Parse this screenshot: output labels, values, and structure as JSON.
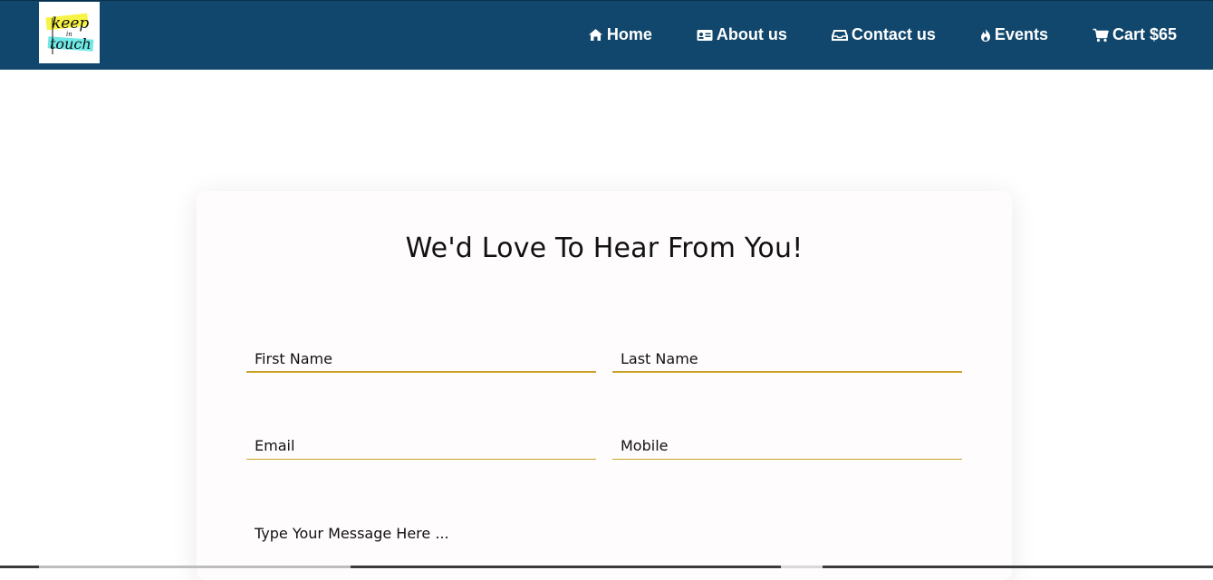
{
  "logo": {
    "line1": "keep",
    "line2": "in",
    "line3": "touch"
  },
  "nav": {
    "items": [
      {
        "label": "Home",
        "icon": "home-icon"
      },
      {
        "label": "About us",
        "icon": "id-card-icon"
      },
      {
        "label": "Contact us",
        "icon": "inbox-icon"
      },
      {
        "label": "Events",
        "icon": "fire-icon"
      },
      {
        "label": "Cart $65",
        "icon": "cart-icon"
      }
    ]
  },
  "form": {
    "title": "We'd Love To Hear From You!",
    "first_name_placeholder": "First Name",
    "last_name_placeholder": "Last Name",
    "email_placeholder": "Email",
    "mobile_placeholder": "Mobile",
    "message_placeholder": "Type Your Message Here ..."
  },
  "colors": {
    "navbar": "#11476c",
    "field_underline": "#c9a227",
    "card_background": "#fffcfd"
  }
}
